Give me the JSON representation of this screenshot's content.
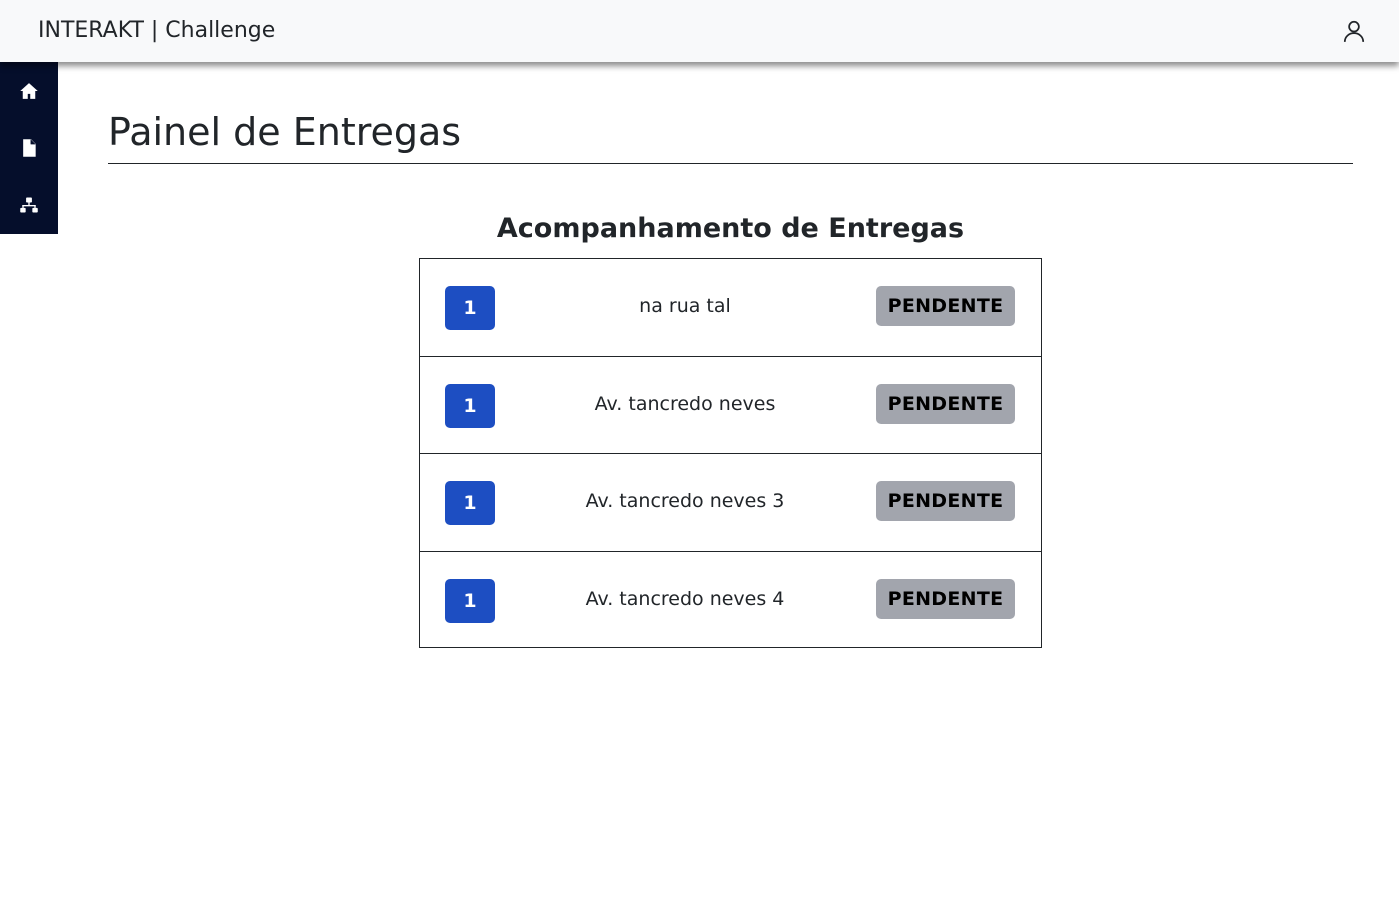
{
  "header": {
    "brand": "INTERAKT | Challenge",
    "user_icon": "user-icon"
  },
  "sidebar": {
    "items": [
      {
        "icon": "home-icon"
      },
      {
        "icon": "document-icon"
      },
      {
        "icon": "sitemap-icon"
      }
    ]
  },
  "main": {
    "title": "Painel de Entregas",
    "section_title": "Acompanhamento de Entregas",
    "deliveries": [
      {
        "id": "1",
        "address": "na rua tal",
        "status": "PENDENTE"
      },
      {
        "id": "1",
        "address": "Av. tancredo neves",
        "status": "PENDENTE"
      },
      {
        "id": "1",
        "address": "Av. tancredo neves 3",
        "status": "PENDENTE"
      },
      {
        "id": "1",
        "address": "Av. tancredo neves 4",
        "status": "PENDENTE"
      }
    ]
  },
  "colors": {
    "sidebar_bg": "#050e2b",
    "id_badge": "#1d4ec2",
    "status_badge": "#a2a5ad"
  }
}
